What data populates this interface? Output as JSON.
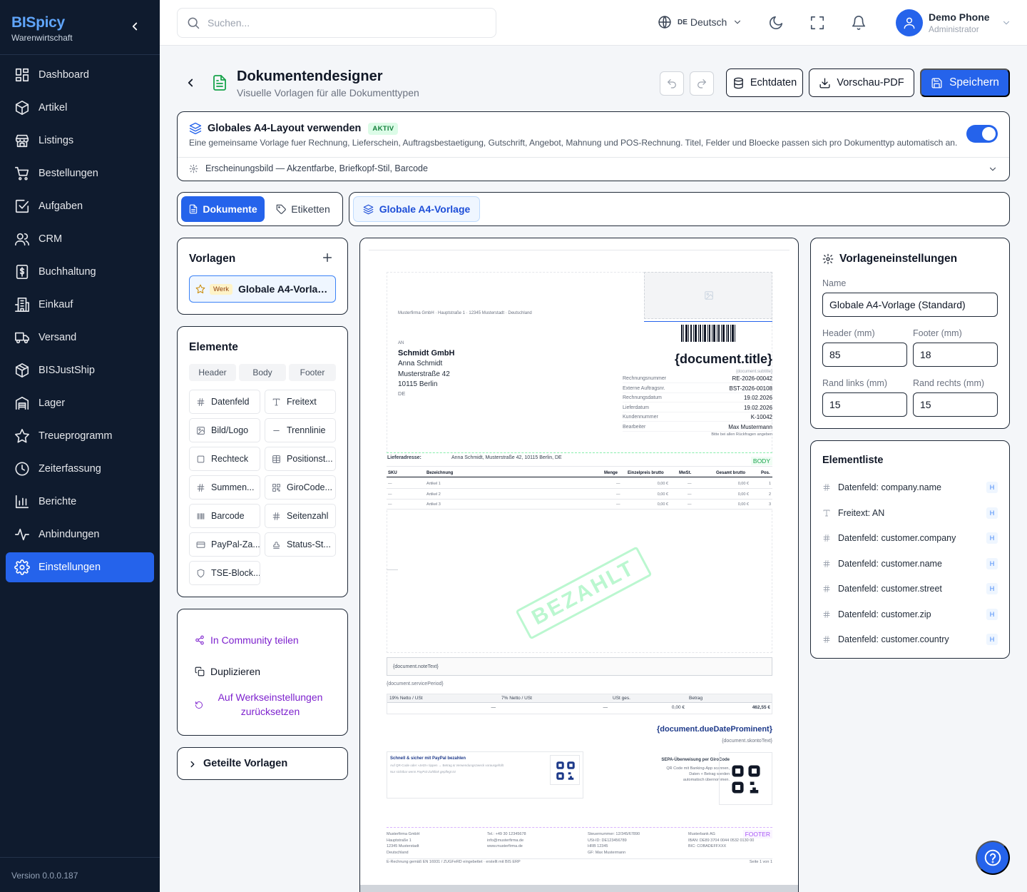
{
  "sidebar": {
    "brand": "BISpicy",
    "brand_sub": "Warenwirtschaft",
    "items": [
      {
        "label": "Dashboard",
        "icon": "dashboard-icon"
      },
      {
        "label": "Artikel",
        "icon": "box-icon"
      },
      {
        "label": "Listings",
        "icon": "store-icon"
      },
      {
        "label": "Bestellungen",
        "icon": "cart-icon"
      },
      {
        "label": "Aufgaben",
        "icon": "checkbox-icon"
      },
      {
        "label": "CRM",
        "icon": "users-icon"
      },
      {
        "label": "Buchhaltung",
        "icon": "dollar-doc-icon"
      },
      {
        "label": "Einkauf",
        "icon": "building-icon"
      },
      {
        "label": "Versand",
        "icon": "truck-icon"
      },
      {
        "label": "BISJustShip",
        "icon": "package-icon"
      },
      {
        "label": "Lager",
        "icon": "warehouse-icon"
      },
      {
        "label": "Treueprogramm",
        "icon": "star-icon"
      },
      {
        "label": "Zeiterfassung",
        "icon": "clock-icon"
      },
      {
        "label": "Berichte",
        "icon": "bar-chart-icon"
      },
      {
        "label": "Anbindungen",
        "icon": "activity-icon"
      },
      {
        "label": "Einstellungen",
        "icon": "gear-icon",
        "active": true
      }
    ],
    "version": "Version 0.0.0.187"
  },
  "topbar": {
    "search_placeholder": "Suchen...",
    "lang_code": "DE",
    "lang": "Deutsch",
    "user_name": "Demo Phone",
    "user_role": "Administrator"
  },
  "header": {
    "title": "Dokumentendesigner",
    "subtitle": "Visuelle Vorlagen für alle Dokumenttypen",
    "echtdaten": "Echtdaten",
    "preview": "Vorschau-PDF",
    "save": "Speichern"
  },
  "global": {
    "title": "Globales A4-Layout verwenden",
    "badge": "AKTIV",
    "desc": "Eine gemeinsame Vorlage fuer Rechnung, Lieferschein, Auftragsbestaetigung, Gutschrift, Angebot, Mahnung und POS-Rechnung. Titel, Felder und Bloecke passen sich pro Dokumenttyp automatisch an.",
    "appearance": "Erscheinungsbild — Akzentfarbe, Briefkopf-Stil, Barcode",
    "enabled": true
  },
  "tabs": {
    "documents": "Dokumente",
    "labels": "Etiketten",
    "global_template": "Globale A4-Vorlage"
  },
  "templates": {
    "title": "Vorlagen",
    "item_badge": "Werk",
    "item_name": "Globale A4-Vorlage (Standard)"
  },
  "elements": {
    "title": "Elemente",
    "segments": [
      "Header",
      "Body",
      "Footer"
    ],
    "items": [
      "Datenfeld",
      "Freitext",
      "Bild/Logo",
      "Trennlinie",
      "Rechteck",
      "Positionst...",
      "Summen...",
      "GiroCode...",
      "Barcode",
      "Seitenzahl",
      "PayPal-Za...",
      "Status-St...",
      "TSE-Block..."
    ]
  },
  "actions": {
    "share": "In Community teilen",
    "duplicate": "Duplizieren",
    "reset": "Auf Werkseinstellungen zurücksetzen",
    "shared": "Geteilte Vorlagen"
  },
  "doc": {
    "sender_line": "Musterfirma GmbH · Hauptstraße 1 · 12345 Musterstadt · Deutschland",
    "an": "AN",
    "company": "Schmidt GmbH",
    "name": "Anna Schmidt",
    "street": "Musterstraße 42",
    "zip": "10115 Berlin",
    "country": "DE",
    "title": "{document.title}",
    "subtitle": "{document.subtitle}",
    "meta": [
      {
        "k": "Rechnungsnummer",
        "v": "RE-2026-00042"
      },
      {
        "k": "Externe Auftragsnr.",
        "v": "BST-2026-00108"
      },
      {
        "k": "Rechnungsdatum",
        "v": "19.02.2026"
      },
      {
        "k": "Lieferdatum",
        "v": "19.02.2026"
      },
      {
        "k": "Kundennummer",
        "v": "K-10042"
      },
      {
        "k": "Bearbeiter",
        "v": "Max Mustermann"
      }
    ],
    "meta_note": "Bitte bei allen Rückfragen angeben",
    "delivery_label": "Lieferadresse:",
    "delivery": "Anna Schmidt, Musterstraße 42, 10115 Berlin, DE",
    "body_tag": "BODY",
    "table_head": [
      "SKU",
      "Bezeichnung",
      "Menge",
      "Einzelpreis brutto",
      "MwSt.",
      "Gesamt brutto",
      "Pos."
    ],
    "rows": [
      {
        "sku": "—",
        "name": "Artikel 1",
        "qty": "—",
        "price": "0,00 €",
        "vat": "—",
        "total": "0,00 €",
        "pos": "1"
      },
      {
        "sku": "—",
        "name": "Artikel 2",
        "qty": "—",
        "price": "0,00 €",
        "vat": "—",
        "total": "0,00 €",
        "pos": "2"
      },
      {
        "sku": "—",
        "name": "Artikel 3",
        "qty": "—",
        "price": "0,00 €",
        "vat": "—",
        "total": "0,00 €",
        "pos": "3"
      }
    ],
    "stamp": "BEZAHLT",
    "note": "{document.noteText}",
    "service": "{document.servicePeriod}",
    "tax_head": [
      "19% Netto / USt",
      "7% Netto / USt",
      "USt ges.",
      "Betrag"
    ],
    "tax_vals": [
      "—",
      "—",
      "0,00 €",
      "462,55 €"
    ],
    "due": "{document.dueDateProminent}",
    "skonto": "{document.skontoText}",
    "paypal_title": "Schnell & sicher mit PayPal bezahlen",
    "paypal_line1": "Auf QR-Code oder »Jetzt« tippen → Betrag & Verwendungszweck vorausgefüllt",
    "paypal_line2": "Nur sichtbar wenn PayPal-Zahllink gepflegt ist",
    "sepa_title": "SEPA-Überweisung per GiroCode",
    "sepa_lines": [
      "QR Code mit Banking-App scannen,",
      "Daten + Betrag werden",
      "automatisch übernommen."
    ],
    "footer_tag": "FOOTER",
    "footer_cols": [
      [
        "Musterfirma GmbH",
        "Hauptstraße 1",
        "12345 Musterstadt",
        "Deutschland"
      ],
      [
        "Tel.: +49 30 12345678",
        "info@musterfirma.de",
        "www.musterfirma.de"
      ],
      [
        "Steuernummer: 12/345/67890",
        "USt-ID: DE123456789",
        "HRB 12345",
        "GF: Max Mustermann"
      ],
      [
        "Musterbank AG",
        "IBAN: DE89 3704 0044 0532 0130 00",
        "BIC: COBADEFFXXX"
      ]
    ],
    "einvoice": "E-Rechnung gemäß EN 16931 / ZUGFeRD eingebettet · erstellt mit BIS ERP",
    "page": "Seite 1 von 1"
  },
  "settings": {
    "title": "Vorlageneinstellungen",
    "name_label": "Name",
    "name": "Globale A4-Vorlage (Standard)",
    "header_label": "Header (mm)",
    "header": "85",
    "footer_label": "Footer (mm)",
    "footer": "18",
    "left_label": "Rand links (mm)",
    "left": "15",
    "right_label": "Rand rechts (mm)",
    "right": "15"
  },
  "elementlist": {
    "title": "Elementliste",
    "items": [
      {
        "label": "Datenfeld: company.name",
        "tag": "H"
      },
      {
        "label": "Freitext: AN",
        "tag": "H"
      },
      {
        "label": "Datenfeld: customer.company",
        "tag": "H"
      },
      {
        "label": "Datenfeld: customer.name",
        "tag": "H"
      },
      {
        "label": "Datenfeld: customer.street",
        "tag": "H"
      },
      {
        "label": "Datenfeld: customer.zip",
        "tag": "H"
      },
      {
        "label": "Datenfeld: customer.country",
        "tag": "H"
      }
    ]
  },
  "colors": {
    "accent": "#2563eb",
    "sidebar": "#0f1b2e",
    "success": "#16a34a",
    "purple": "#7e22ce"
  }
}
